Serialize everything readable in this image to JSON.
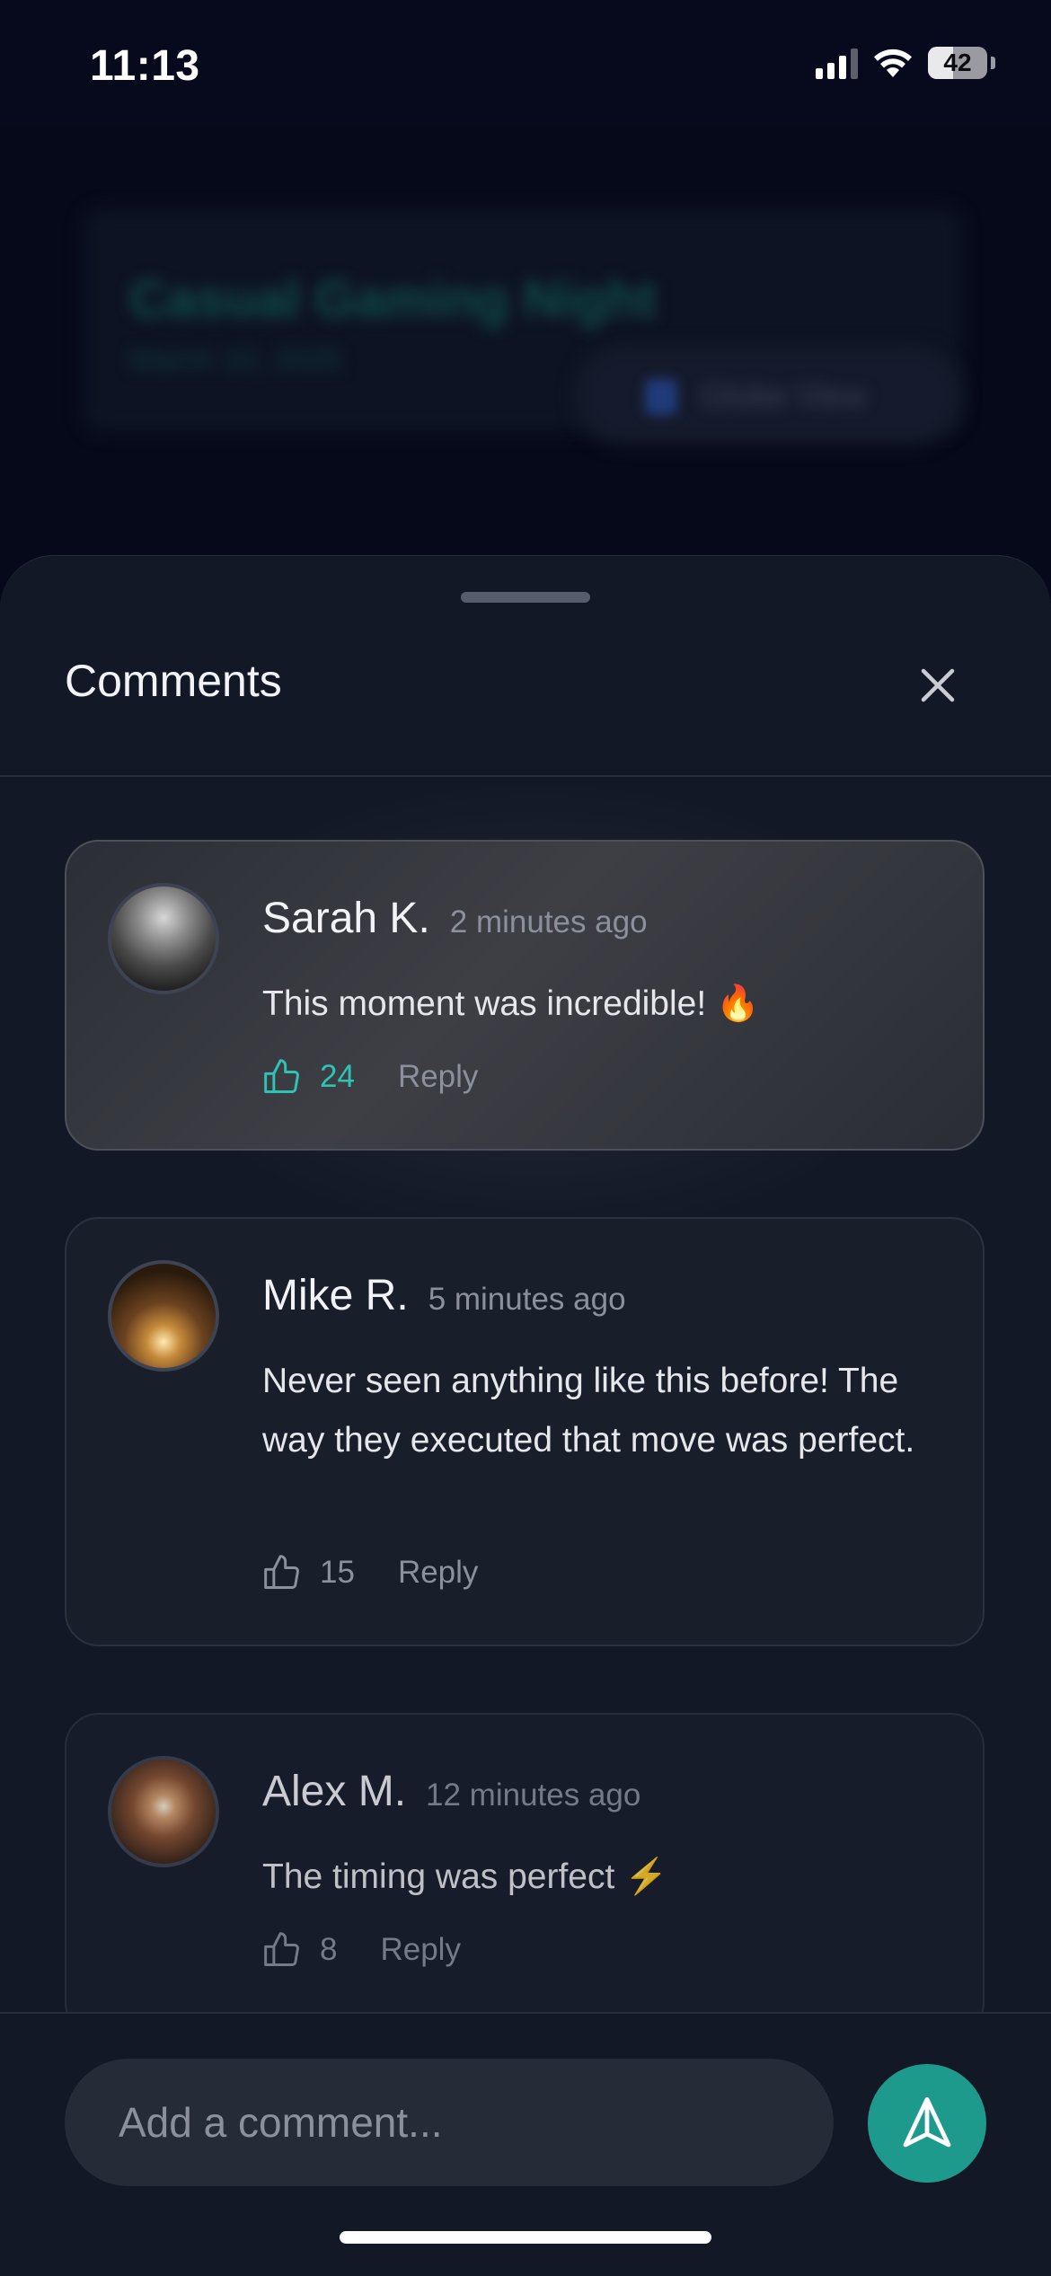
{
  "status_bar": {
    "time": "11:13",
    "battery": "42"
  },
  "background": {
    "title": "Casual Gaming Night",
    "date": "March 10, 2025",
    "button_label": "Globe View"
  },
  "sheet": {
    "title": "Comments"
  },
  "comments": [
    {
      "name": "Sarah K.",
      "time_ago": "2 minutes ago",
      "text": "This moment was incredible! 🔥",
      "likes": "24",
      "liked": true,
      "reply_label": "Reply"
    },
    {
      "name": "Mike R.",
      "time_ago": "5 minutes ago",
      "text": "Never seen anything like this before! The way they executed that move was perfect.",
      "likes": "15",
      "liked": false,
      "reply_label": "Reply"
    },
    {
      "name": "Alex M.",
      "time_ago": "12 minutes ago",
      "text": "The timing was perfect ⚡",
      "likes": "8",
      "liked": false,
      "reply_label": "Reply"
    }
  ],
  "composer": {
    "placeholder": "Add a comment..."
  },
  "colors": {
    "accent": "#2fc3b3",
    "send_button": "#1d9a8c",
    "sheet_bg": "#121826"
  },
  "icons": {
    "like": "thumbs-up-icon",
    "send": "send-icon",
    "close": "close-icon"
  }
}
